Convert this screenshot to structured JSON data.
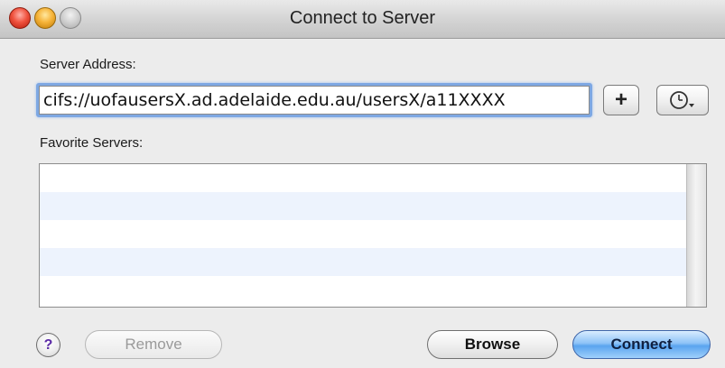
{
  "window": {
    "title": "Connect to Server"
  },
  "form": {
    "server_address_label": "Server Address:",
    "server_address_value": "cifs://uofausersX.ad.adelaide.edu.au/usersX/a11XXXX",
    "favorite_servers_label": "Favorite Servers:"
  },
  "toolbar": {
    "add_label": "+",
    "recent_icon": "clock-dropdown-icon"
  },
  "favorites": {
    "items": []
  },
  "buttons": {
    "help_label": "?",
    "remove_label": "Remove",
    "browse_label": "Browse",
    "connect_label": "Connect"
  },
  "colors": {
    "focus_ring": "#7ea8e3",
    "alternate_row": "#edf3fd",
    "default_button": "#5aa4ef",
    "help_glyph": "#5b2aa6"
  }
}
